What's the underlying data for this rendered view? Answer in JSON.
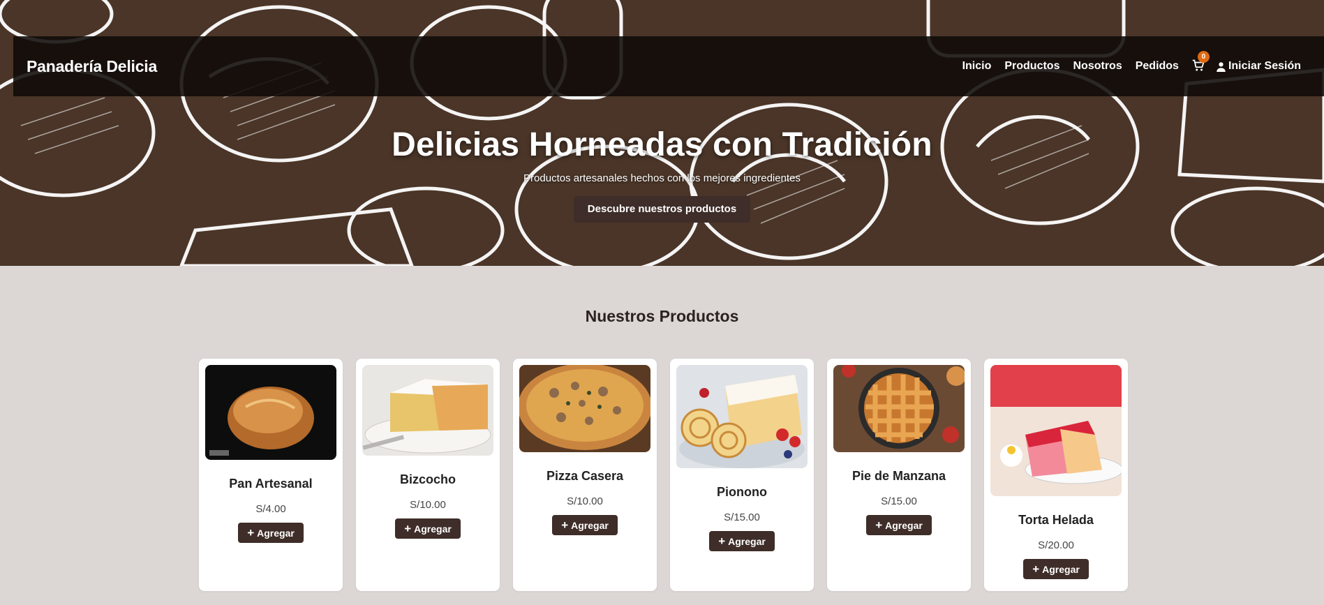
{
  "navbar": {
    "brand": "Panadería Delicia",
    "links": [
      "Inicio",
      "Productos",
      "Nosotros",
      "Pedidos"
    ],
    "cart_count": "0",
    "login_label": "Iniciar Sesión"
  },
  "hero": {
    "title": "Delicias Horneadas con Tradición",
    "subtitle": "Productos artesanales hechos con los mejores ingredientes",
    "cta_label": "Descubre nuestros productos"
  },
  "products_section": {
    "title": "Nuestros Productos",
    "add_label": "Agregar",
    "items": [
      {
        "name": "Pan Artesanal",
        "price": "S/4.00",
        "image": "bread-loaf"
      },
      {
        "name": "Bizcocho",
        "price": "S/10.00",
        "image": "sponge-cake"
      },
      {
        "name": "Pizza Casera",
        "price": "S/10.00",
        "image": "pizza"
      },
      {
        "name": "Pionono",
        "price": "S/15.00",
        "image": "swiss-roll"
      },
      {
        "name": "Pie de Manzana",
        "price": "S/15.00",
        "image": "apple-pie"
      },
      {
        "name": "Torta Helada",
        "price": "S/20.00",
        "image": "jelly-cake"
      }
    ]
  },
  "colors": {
    "hero_bg": "#4a3528",
    "navbar_bg": "#140e0b",
    "button_bg": "#3e2d28",
    "badge": "#e06a10",
    "page_bg": "#dcd6d5"
  }
}
